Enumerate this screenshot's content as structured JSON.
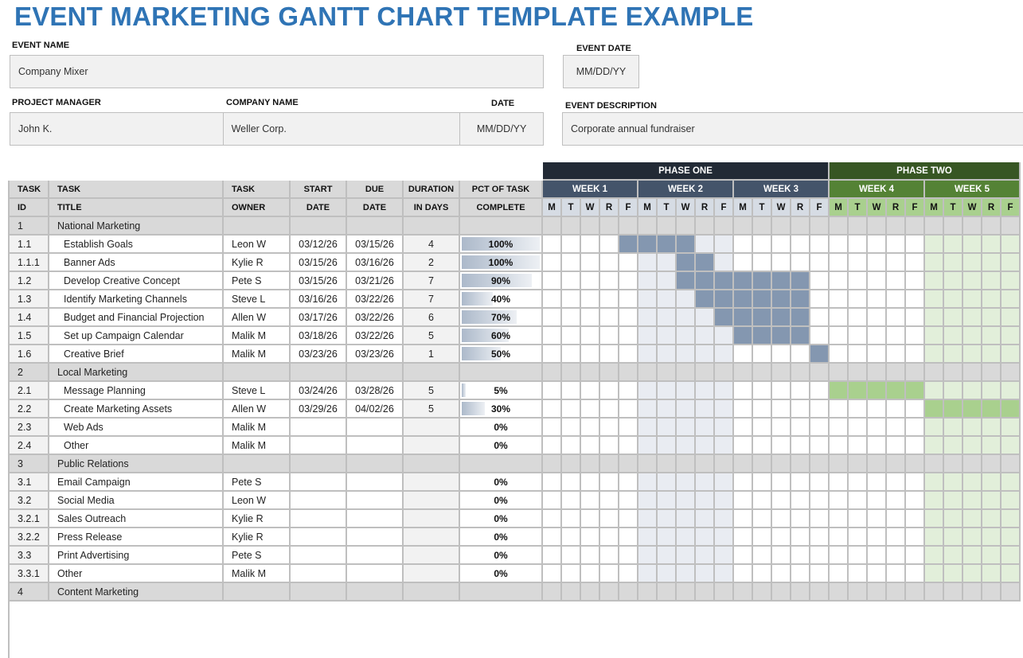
{
  "title": "EVENT MARKETING GANTT CHART TEMPLATE EXAMPLE",
  "event": {
    "name_label": "EVENT NAME",
    "name": "Company Mixer",
    "date_label": "EVENT DATE",
    "date": "MM/DD/YY",
    "pm_label": "PROJECT MANAGER",
    "pm": "John K.",
    "company_label": "COMPANY NAME",
    "company": "Weller Corp.",
    "doc_date_label": "DATE",
    "doc_date": "MM/DD/YY",
    "desc_label": "EVENT DESCRIPTION",
    "desc": "Corporate annual fundraiser"
  },
  "columns": {
    "row1": [
      "TASK",
      "TASK",
      "TASK",
      "START",
      "DUE",
      "DURATION",
      "PCT OF TASK"
    ],
    "row2": [
      "ID",
      "TITLE",
      "OWNER",
      "DATE",
      "DATE",
      "IN DAYS",
      "COMPLETE"
    ]
  },
  "phases": [
    {
      "label": "PHASE ONE",
      "weeks": 3
    },
    {
      "label": "PHASE TWO",
      "weeks": 2
    }
  ],
  "weeks": [
    "WEEK 1",
    "WEEK 2",
    "WEEK 3",
    "WEEK 4",
    "WEEK 5"
  ],
  "days": [
    "M",
    "T",
    "W",
    "R",
    "F"
  ],
  "colors": {
    "title": "#2f74b5",
    "phase_one": "#222a35",
    "phase_two": "#375623",
    "week_phase_one": "#44546a",
    "week_phase_two": "#548235",
    "bar_phase_one": "#8497b0",
    "bar_phase_two": "#a9d08e",
    "shade_phase_one": "#e9ecf2",
    "shade_phase_two": "#e2efda",
    "section_row": "#d9d9d9"
  },
  "rows": [
    {
      "id": "1",
      "title": "National Marketing",
      "section": true
    },
    {
      "id": "1.1",
      "title": "Establish Goals",
      "owner": "Leon W",
      "start": "03/12/26",
      "due": "03/15/26",
      "duration": "4",
      "pct": "100%",
      "pct_value": 100,
      "bar": [
        4,
        7
      ]
    },
    {
      "id": "1.1.1",
      "title": "Banner Ads",
      "owner": "Kylie R",
      "start": "03/15/26",
      "due": "03/16/26",
      "duration": "2",
      "pct": "100%",
      "pct_value": 100,
      "bar": [
        7,
        8
      ]
    },
    {
      "id": "1.2",
      "title": "Develop Creative Concept",
      "owner": "Pete S",
      "start": "03/15/26",
      "due": "03/21/26",
      "duration": "7",
      "pct": "90%",
      "pct_value": 90,
      "bar": [
        7,
        13
      ]
    },
    {
      "id": "1.3",
      "title": "Identify Marketing Channels",
      "owner": "Steve L",
      "start": "03/16/26",
      "due": "03/22/26",
      "duration": "7",
      "pct": "40%",
      "pct_value": 40,
      "bar": [
        8,
        13
      ]
    },
    {
      "id": "1.4",
      "title": "Budget and Financial Projection",
      "owner": "Allen W",
      "start": "03/17/26",
      "due": "03/22/26",
      "duration": "6",
      "pct": "70%",
      "pct_value": 70,
      "bar": [
        9,
        13
      ]
    },
    {
      "id": "1.5",
      "title": "Set up Campaign Calendar",
      "owner": "Malik M",
      "start": "03/18/26",
      "due": "03/22/26",
      "duration": "5",
      "pct": "60%",
      "pct_value": 60,
      "bar": [
        10,
        13
      ]
    },
    {
      "id": "1.6",
      "title": "Creative Brief",
      "owner": "Malik M",
      "start": "03/23/26",
      "due": "03/23/26",
      "duration": "1",
      "pct": "50%",
      "pct_value": 50,
      "bar": [
        14,
        14
      ]
    },
    {
      "id": "2",
      "title": "Local Marketing",
      "section": true
    },
    {
      "id": "2.1",
      "title": "Message Planning",
      "owner": "Steve L",
      "start": "03/24/26",
      "due": "03/28/26",
      "duration": "5",
      "pct": "5%",
      "pct_value": 5,
      "bar": [
        15,
        19
      ]
    },
    {
      "id": "2.2",
      "title": "Create Marketing Assets",
      "owner": "Allen W",
      "start": "03/29/26",
      "due": "04/02/26",
      "duration": "5",
      "pct": "30%",
      "pct_value": 30,
      "bar": [
        20,
        24
      ]
    },
    {
      "id": "2.3",
      "title": "Web Ads",
      "owner": "Malik M",
      "start": "",
      "due": "",
      "duration": "",
      "pct": "0%",
      "pct_value": 0
    },
    {
      "id": "2.4",
      "title": "Other",
      "owner": "Malik M",
      "start": "",
      "due": "",
      "duration": "",
      "pct": "0%",
      "pct_value": 0
    },
    {
      "id": "3",
      "title": "Public Relations",
      "section": true
    },
    {
      "id": "3.1",
      "title": "Email Campaign",
      "owner": "Pete S",
      "start": "",
      "due": "",
      "duration": "",
      "pct": "0%",
      "pct_value": 0,
      "flat": true
    },
    {
      "id": "3.2",
      "title": "Social Media",
      "owner": "Leon W",
      "start": "",
      "due": "",
      "duration": "",
      "pct": "0%",
      "pct_value": 0,
      "flat": true
    },
    {
      "id": "3.2.1",
      "title": "Sales Outreach",
      "owner": "Kylie R",
      "start": "",
      "due": "",
      "duration": "",
      "pct": "0%",
      "pct_value": 0,
      "flat": true
    },
    {
      "id": "3.2.2",
      "title": "Press Release",
      "owner": "Kylie R",
      "start": "",
      "due": "",
      "duration": "",
      "pct": "0%",
      "pct_value": 0,
      "flat": true
    },
    {
      "id": "3.3",
      "title": "Print Advertising",
      "owner": "Pete S",
      "start": "",
      "due": "",
      "duration": "",
      "pct": "0%",
      "pct_value": 0,
      "flat": true
    },
    {
      "id": "3.3.1",
      "title": "Other",
      "owner": "Malik M",
      "start": "",
      "due": "",
      "duration": "",
      "pct": "0%",
      "pct_value": 0,
      "flat": true
    },
    {
      "id": "4",
      "title": "Content Marketing",
      "section": true
    }
  ]
}
